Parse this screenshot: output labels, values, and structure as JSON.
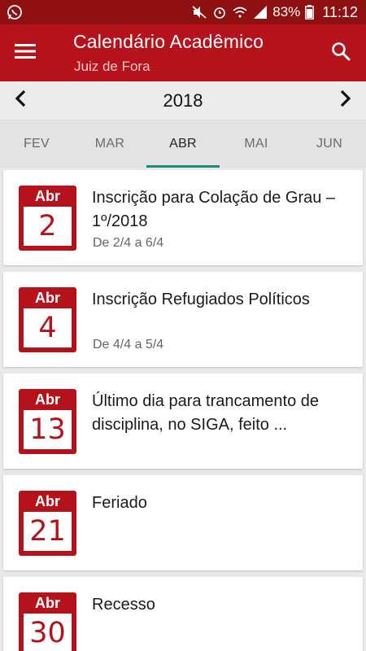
{
  "status_bar": {
    "battery": "83%",
    "time": "11:12",
    "icons": [
      "whatsapp-icon",
      "mute-icon",
      "alarm-icon",
      "wifi-icon",
      "signal-icon",
      "battery-icon"
    ]
  },
  "app_bar": {
    "title": "Calendário Acadêmico",
    "subtitle": "Juiz de Fora",
    "menu_icon": "hamburger-menu-icon",
    "search_icon": "search-icon"
  },
  "year_nav": {
    "year": "2018",
    "prev_icon": "chevron-left-icon",
    "next_icon": "chevron-right-icon"
  },
  "months": {
    "tabs": [
      {
        "label": "FEV"
      },
      {
        "label": "MAR"
      },
      {
        "label": "ABR"
      },
      {
        "label": "MAI"
      },
      {
        "label": "JUN"
      }
    ],
    "selected": "ABR"
  },
  "events": [
    {
      "month": "Abr",
      "day": "2",
      "title": "Inscrição para Colação de Grau – 1º/2018",
      "range": "De 2/4 a 6/4"
    },
    {
      "month": "Abr",
      "day": "4",
      "title": "Inscrição Refugiados Políticos",
      "range": "De 4/4 a 5/4"
    },
    {
      "month": "Abr",
      "day": "13",
      "title": "Último dia para trancamento de disciplina, no SIGA, feito ...",
      "range": ""
    },
    {
      "month": "Abr",
      "day": "21",
      "title": "Feriado",
      "range": ""
    },
    {
      "month": "Abr",
      "day": "30",
      "title": "Recesso",
      "range": ""
    }
  ],
  "colors": {
    "status_bar": "#8f1010",
    "primary": "#b5121b",
    "tab_indicator": "#1d8a82"
  }
}
